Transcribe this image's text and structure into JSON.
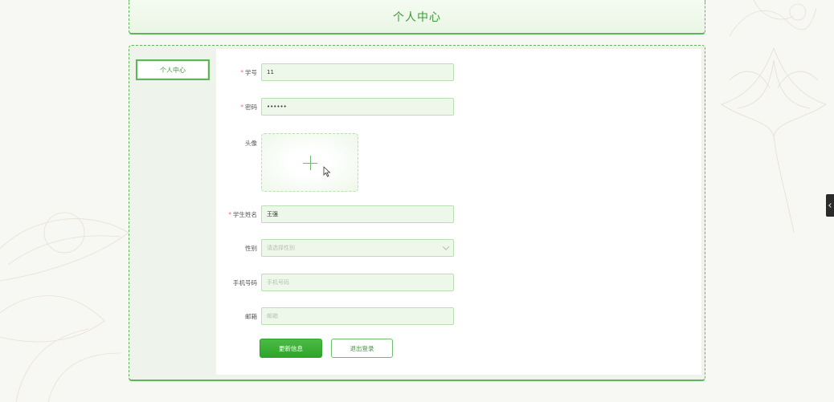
{
  "header": {
    "title": "个人中心"
  },
  "sidebar": {
    "items": [
      {
        "label": "个人中心",
        "active": true
      }
    ]
  },
  "form": {
    "student_id": {
      "label": "学号",
      "required": true,
      "value": "11"
    },
    "password": {
      "label": "密码",
      "required": true,
      "value": "••••••"
    },
    "avatar": {
      "label": "头像",
      "icon": "plus-icon"
    },
    "student_name": {
      "label": "学生姓名",
      "required": true,
      "value": "王强"
    },
    "gender": {
      "label": "性别",
      "placeholder": "请选择性别"
    },
    "phone": {
      "label": "手机号码",
      "placeholder": "手机号码"
    },
    "email": {
      "label": "邮箱",
      "placeholder": "邮箱"
    }
  },
  "buttons": {
    "update": "更新信息",
    "logout": "退出登录"
  },
  "colors": {
    "accent": "#5fb65a",
    "primary_button": "#2ea52a",
    "required_mark": "#f56c6c"
  }
}
